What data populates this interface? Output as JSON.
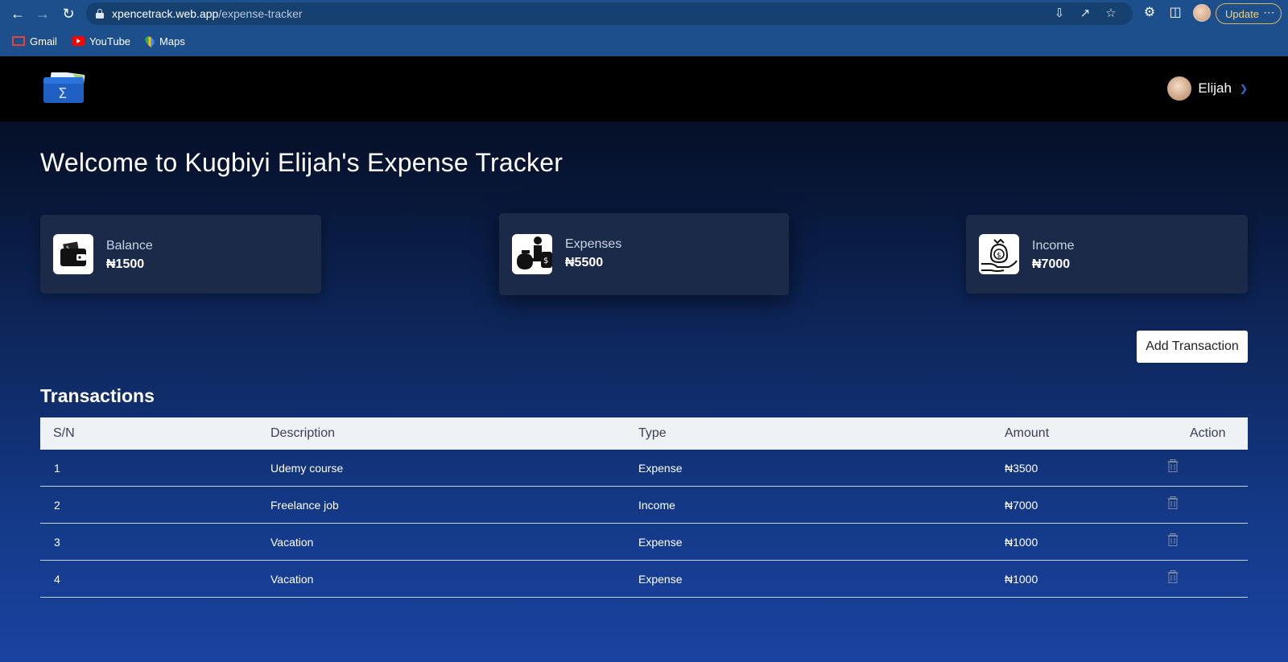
{
  "browser": {
    "url_host": "xpencetrack.web.app",
    "url_path": "/expense-tracker",
    "update_label": "Update",
    "bookmarks": [
      {
        "label": "Gmail",
        "icon": "gmail-icon"
      },
      {
        "label": "YouTube",
        "icon": "youtube-icon"
      },
      {
        "label": "Maps",
        "icon": "maps-icon"
      }
    ]
  },
  "header": {
    "user_name": "Elijah"
  },
  "main": {
    "title": "Welcome to Kugbiyi Elijah's Expense Tracker",
    "cards": {
      "balance": {
        "label": "Balance",
        "value": "₦1500",
        "icon": "wallet-icon"
      },
      "expenses": {
        "label": "Expenses",
        "value": "₦5500",
        "icon": "money-bag-scale-icon"
      },
      "income": {
        "label": "Income",
        "value": "₦7000",
        "icon": "hand-money-bag-icon"
      }
    },
    "add_button_label": "Add Transaction",
    "transactions_title": "Transactions"
  },
  "table": {
    "columns": [
      "S/N",
      "Description",
      "Type",
      "Amount",
      "Action"
    ],
    "rows": [
      {
        "sn": "1",
        "description": "Udemy course",
        "type": "Expense",
        "amount": "₦3500"
      },
      {
        "sn": "2",
        "description": "Freelance job",
        "type": "Income",
        "amount": "₦7000"
      },
      {
        "sn": "3",
        "description": "Vacation",
        "type": "Expense",
        "amount": "₦1000"
      },
      {
        "sn": "4",
        "description": "Vacation",
        "type": "Expense",
        "amount": "₦1000"
      }
    ]
  },
  "colors": {
    "chrome": "#1d4f8c",
    "header": "#000000",
    "card": "#1c2a4a",
    "table_header": "#eef2f5",
    "accent": "#2e73d8"
  }
}
